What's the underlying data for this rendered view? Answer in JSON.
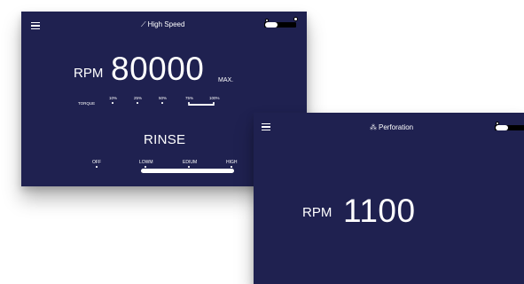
{
  "screen1": {
    "mode_title": "High Speed",
    "mode_icon": "bur-icon",
    "rpm_label": "RPM",
    "rpm_value": "80000",
    "rpm_suffix": "MAX.",
    "torque_label": "TORQUE",
    "torque_levels": [
      "10%",
      "25%",
      "50%",
      "75%",
      "100%"
    ],
    "torque_level": 0.87,
    "rinse_label": "RINSE",
    "rinse_levels": [
      "OFF",
      "LOWM",
      "EDIUM",
      "HIGH"
    ],
    "rinse_level": 1.0
  },
  "screen2": {
    "mode_title": "Perforation",
    "mode_icon": "drill-icon",
    "rpm_label": "RPM",
    "rpm_value": "1100"
  },
  "colors": {
    "screen_bg": "#1f2150",
    "text": "#ffffff",
    "toggle_track": "#000000"
  }
}
